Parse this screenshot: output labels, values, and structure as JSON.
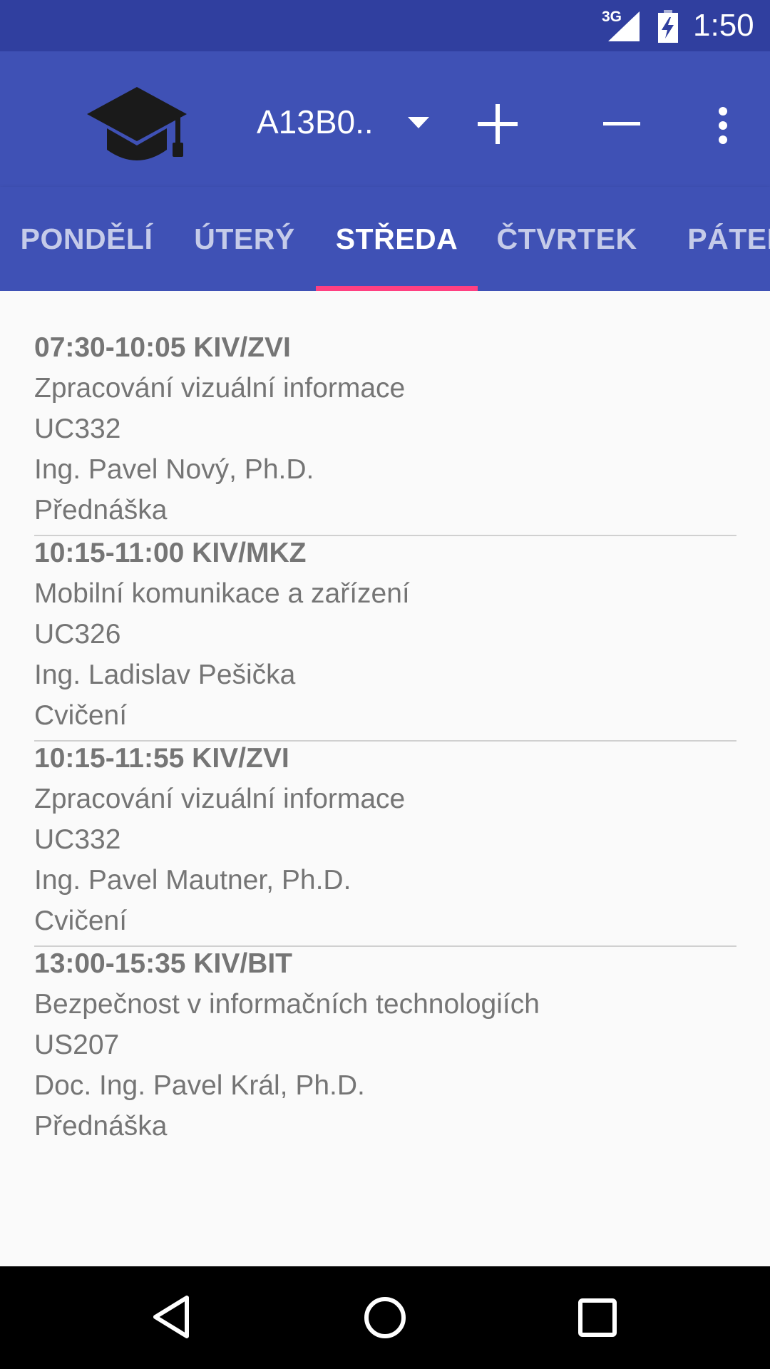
{
  "status_bar": {
    "network": "3G",
    "time": "1:50",
    "icons": [
      "signal-icon",
      "battery-charging-icon"
    ]
  },
  "toolbar": {
    "logo_icon": "graduation-cap-icon",
    "group": "A13B0..",
    "dropdown_icon": "dropdown-arrow-icon",
    "add_icon": "plus-icon",
    "remove_icon": "minus-icon",
    "more_icon": "more-vert-icon"
  },
  "tabs": [
    {
      "label": "PONDĚLÍ",
      "active": false
    },
    {
      "label": "ÚTERÝ",
      "active": false
    },
    {
      "label": "STŘEDA",
      "active": true
    },
    {
      "label": "ČTVRTEK",
      "active": false
    },
    {
      "label": "PÁTEK",
      "active": false
    }
  ],
  "lessons": [
    {
      "heading": "07:30-10:05 KIV/ZVI",
      "name": "Zpracování vizuální informace",
      "room": "UC332",
      "teacher": "Ing. Pavel Nový, Ph.D.",
      "type": "Přednáška"
    },
    {
      "heading": "10:15-11:00 KIV/MKZ",
      "name": "Mobilní komunikace a zařízení",
      "room": "UC326",
      "teacher": "Ing. Ladislav Pešička",
      "type": "Cvičení"
    },
    {
      "heading": "10:15-11:55 KIV/ZVI",
      "name": "Zpracování vizuální informace",
      "room": "UC332",
      "teacher": "Ing. Pavel Mautner, Ph.D.",
      "type": "Cvičení"
    },
    {
      "heading": "13:00-15:35 KIV/BIT",
      "name": "Bezpečnost v informačních technologiích",
      "room": "US207",
      "teacher": "Doc. Ing. Pavel Král, Ph.D.",
      "type": "Přednáška"
    }
  ],
  "nav_bar": {
    "icons": [
      "back-icon",
      "home-icon",
      "recent-apps-icon"
    ]
  },
  "colors": {
    "primary": "#3f51b5",
    "primary_dark": "#303f9f",
    "accent": "#ff4081",
    "text_secondary": "#757575"
  }
}
